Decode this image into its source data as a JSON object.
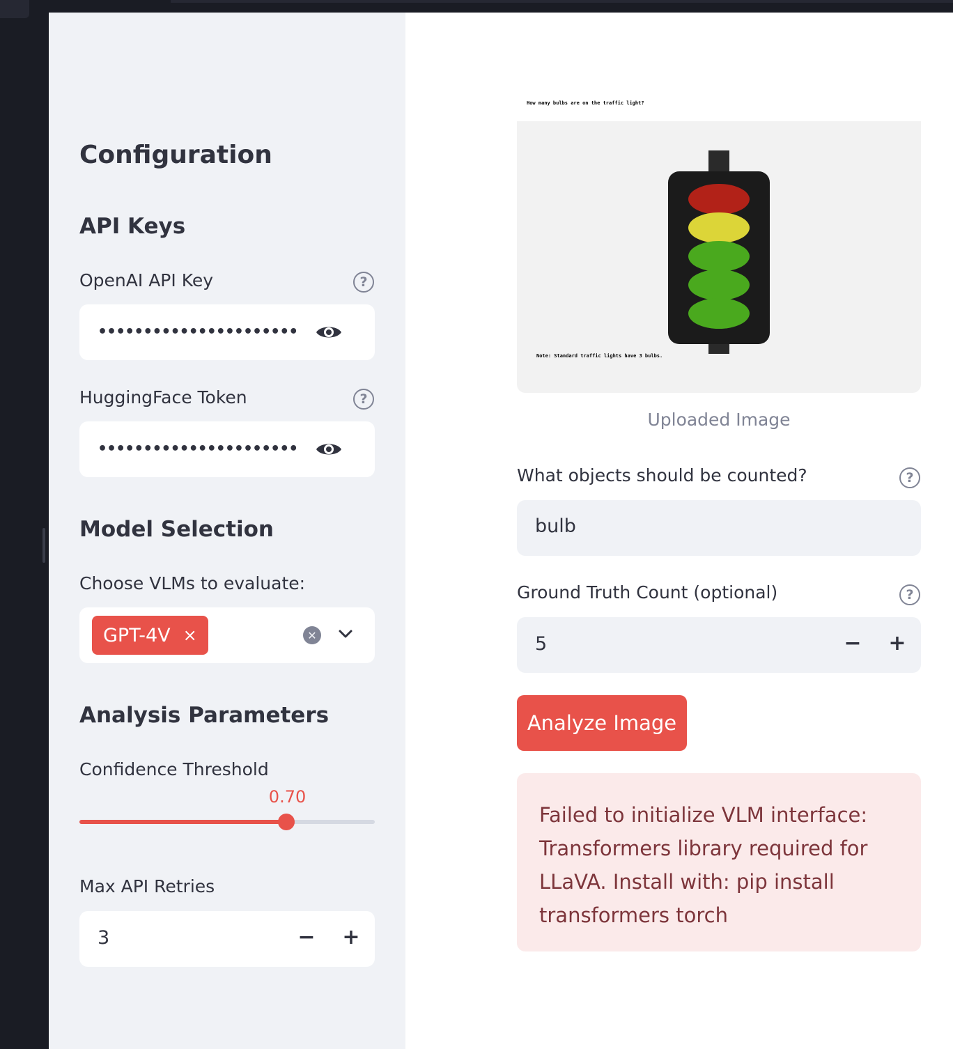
{
  "sidebar": {
    "title": "Configuration",
    "api_keys_heading": "API Keys",
    "openai_label": "OpenAI API Key",
    "openai_value": "••••••••••••••••••••••••••••••••••",
    "hf_label": "HuggingFace Token",
    "hf_value": "••••••••••••••••••••••••••••••••••",
    "model_heading": "Model Selection",
    "choose_label": "Choose VLMs to evaluate:",
    "selected_models": [
      "GPT-4V"
    ],
    "tag_remove": "×",
    "analysis_heading": "Analysis Parameters",
    "confidence_label": "Confidence Threshold",
    "confidence_value_text": "0.70",
    "confidence_fraction": 0.7,
    "retries_label": "Max API Retries",
    "retries_value": "3"
  },
  "main": {
    "image_top_text": "How many bulbs are on the traffic light?",
    "image_note_text": "Note: Standard traffic lights have 3 bulbs.",
    "image_caption": "Uploaded Image",
    "objects_label": "What objects should be counted?",
    "objects_value": "bulb",
    "gt_label": "Ground Truth Count (optional)",
    "gt_value": "5",
    "analyze_button": "Analyze Image",
    "error_message": "Failed to initialize VLM interface: Transformers library required for LLaVA. Install with: pip install transformers torch"
  },
  "icons": {
    "help": "?",
    "minus": "−",
    "plus": "+",
    "clear": "✕"
  },
  "colors": {
    "accent": "#e8524a",
    "sidebar_bg": "#f0f2f6",
    "error_bg": "#fbeaea",
    "error_text": "#7d353b",
    "bulb_colors": [
      "#b22218",
      "#dcd538",
      "#4aa91e",
      "#4aa91e",
      "#4aa91e"
    ]
  }
}
